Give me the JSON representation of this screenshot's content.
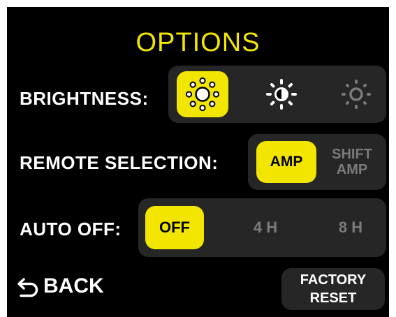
{
  "screen": {
    "title": "OPTIONS"
  },
  "brightness": {
    "label": "BRIGHTNESS:",
    "options": [
      {
        "icon": "sun-high-icon",
        "selected": true
      },
      {
        "icon": "sun-medium-icon",
        "selected": false
      },
      {
        "icon": "sun-low-icon",
        "selected": false
      }
    ]
  },
  "remote_selection": {
    "label": "REMOTE SELECTION:",
    "options": [
      {
        "line1": "AMP",
        "selected": true
      },
      {
        "line1": "SHIFT",
        "line2": "AMP",
        "selected": false
      }
    ]
  },
  "auto_off": {
    "label": "AUTO OFF:",
    "options": [
      {
        "label": "OFF",
        "selected": true
      },
      {
        "label": "4 H",
        "selected": false
      },
      {
        "label": "8 H",
        "selected": false
      }
    ]
  },
  "footer": {
    "back_label": "BACK",
    "back_icon": "back-arrow-icon",
    "reset_line1": "FACTORY",
    "reset_line2": "RESET"
  },
  "colors": {
    "accent": "#f2e600",
    "panel": "#262626",
    "background": "#000000",
    "inactive": "#7b7b7b",
    "text": "#ffffff"
  }
}
